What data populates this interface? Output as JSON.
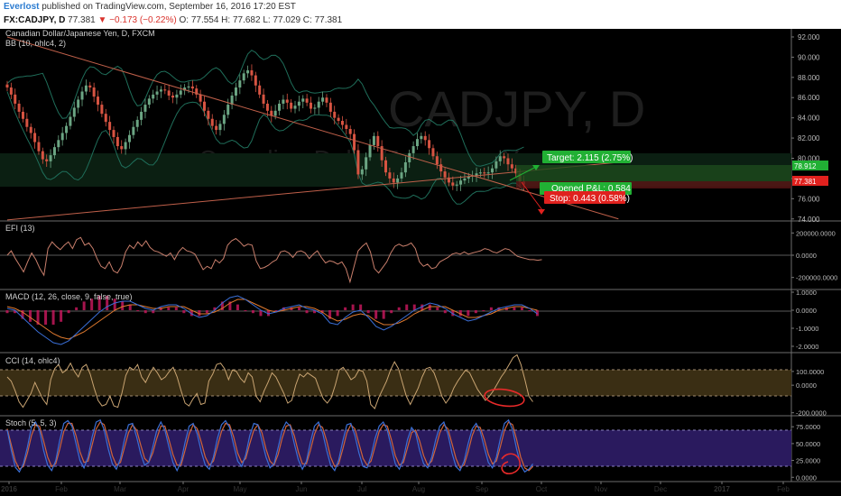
{
  "header": {
    "brand": "Everlost",
    "published": "published on TradingView.com, September 16, 2016 17:20 EST",
    "symbol": "FX:CADJPY, D",
    "last": "77.381",
    "change_arrow": "▼",
    "change": "−0.173 (−0.22%)",
    "ohlc": "O: 77.554  H: 77.682  L: 77.029  C: 77.381"
  },
  "colors": {
    "background": "#000000",
    "candle_up": "#6ba583",
    "candle_down": "#d75442",
    "bollinger": "#1f6e5a",
    "trendline": "#c0604a",
    "indicator_line": "#c9a472",
    "macd_line": "#3a6fd8",
    "signal_line": "#e07a2f",
    "histogram": "#c2185b",
    "stoch_k": "#3b6fd6",
    "stoch_d": "#d0643a",
    "stoch_band": "#2a1a5e",
    "cci_band": "#3a2e14",
    "target_green": "#21b034",
    "stop_red": "#e0211e",
    "annotation_red": "#e82a2a"
  },
  "chart_data": [
    {
      "panel": "price",
      "type": "candlestick",
      "title": "Canadian Dollar/Japanese Yen, D, FXCM",
      "overlay_label": "BB (10, ohlc4, 2)",
      "watermark": "CADJPY, D",
      "watermark_sub": "Canadian Dollar/Japanese Yen",
      "x_ticks": [
        "2016",
        "Feb",
        "Mar",
        "Apr",
        "May",
        "Jun",
        "Jul",
        "Aug",
        "Sep",
        "Oct",
        "Nov",
        "Dec",
        "2017",
        "Feb"
      ],
      "y_ticks": [
        "92.000",
        "90.000",
        "88.000",
        "86.000",
        "84.000",
        "82.000",
        "80.000",
        "78.000",
        "76.000",
        "74.000"
      ],
      "ylim": [
        73.8,
        92.8
      ],
      "closes": [
        87.0,
        86.3,
        85.4,
        84.6,
        83.9,
        83.1,
        82.5,
        81.6,
        80.7,
        79.9,
        79.7,
        80.3,
        81.1,
        81.8,
        82.5,
        83.2,
        84.1,
        85.0,
        85.8,
        86.6,
        87.2,
        87.0,
        86.1,
        85.3,
        84.4,
        83.6,
        82.8,
        82.1,
        81.2,
        80.9,
        81.6,
        82.3,
        83.1,
        83.8,
        84.6,
        85.3,
        85.9,
        86.3,
        86.6,
        86.8,
        86.7,
        86.2,
        86.0,
        86.3,
        86.7,
        87.0,
        87.1,
        86.9,
        86.3,
        85.6,
        84.7,
        83.9,
        83.2,
        82.8,
        83.4,
        84.3,
        85.3,
        86.2,
        87.0,
        87.7,
        88.4,
        88.7,
        88.2,
        87.2,
        86.3,
        85.4,
        84.7,
        84.2,
        84.7,
        85.4,
        85.8,
        85.5,
        84.9,
        85.2,
        85.6,
        85.9,
        85.5,
        84.9,
        85.0,
        85.6,
        86.0,
        85.5,
        84.6,
        84.0,
        83.7,
        83.3,
        82.9,
        82.4,
        80.8,
        78.4,
        78.9,
        80.1,
        81.3,
        82.2,
        81.2,
        79.8,
        78.6,
        78.0,
        77.6,
        78.0,
        78.6,
        79.6,
        80.5,
        81.2,
        81.9,
        82.2,
        81.8,
        81.0,
        80.2,
        79.4,
        78.7,
        78.1,
        77.6,
        77.3,
        77.4,
        77.8,
        78.0,
        78.2,
        78.3,
        78.5,
        78.6,
        78.5,
        78.6,
        79.0,
        79.7,
        80.2,
        80.0,
        79.4,
        79.0,
        78.5,
        77.7,
        77.4
      ],
      "last_price_label": "77.381",
      "bb_upper_label": "78.912",
      "trendline_points": [
        [
          0,
          92.0
        ],
        [
          155,
          74.0
        ]
      ],
      "support_line_points": [
        [
          0,
          73.9
        ],
        [
          155,
          79.6
        ]
      ],
      "target_label": "Target: 2.115 (2.75%)",
      "stop_label": "Stop: 0.443 (0.58%)",
      "pnl_label": "Opened P&L: 0.584"
    },
    {
      "panel": "efi",
      "type": "line",
      "label": "EFI (13)",
      "y_ticks": [
        "200000.0000",
        "0.0000",
        "-200000.0000"
      ],
      "ylim": [
        -300000,
        300000
      ],
      "series": [
        {
          "values": [
            0,
            40000,
            -30000,
            -90000,
            -150000,
            -60000,
            20000,
            -40000,
            -120000,
            -180000,
            60000,
            120000,
            80000,
            50000,
            90000,
            120000,
            60000,
            140000,
            160000,
            90000,
            110000,
            60000,
            -30000,
            -100000,
            -120000,
            -60000,
            -140000,
            -160000,
            -100000,
            30000,
            90000,
            60000,
            120000,
            80000,
            130000,
            70000,
            40000,
            30000,
            10000,
            -10000,
            20000,
            -40000,
            30000,
            70000,
            40000,
            30000,
            10000,
            -60000,
            -130000,
            -100000,
            -120000,
            -40000,
            -70000,
            -30000,
            90000,
            130000,
            150000,
            120000,
            80000,
            100000,
            90000,
            -50000,
            -120000,
            -110000,
            -90000,
            -60000,
            -40000,
            30000,
            40000,
            20000,
            -20000,
            30000,
            40000,
            20000,
            -30000,
            10000,
            40000,
            -20000,
            -70000,
            -50000,
            -60000,
            -80000,
            -60000,
            -120000,
            -240000,
            -100000,
            40000,
            80000,
            110000,
            30000,
            -120000,
            -160000,
            -110000,
            -60000,
            20000,
            80000,
            100000,
            80000,
            90000,
            110000,
            60000,
            -60000,
            -100000,
            -80000,
            -120000,
            -110000,
            -60000,
            -40000,
            -20000,
            10000,
            20000,
            10000,
            30000,
            10000,
            20000,
            30000,
            40000,
            60000,
            50000,
            30000,
            20000,
            40000,
            60000,
            50000,
            20000,
            -10000,
            -20000,
            -30000,
            -40000,
            -40000,
            -45000,
            -40000
          ]
        }
      ]
    },
    {
      "panel": "macd",
      "type": "line",
      "label": "MACD (12, 26, close, 9, false, true)",
      "y_ticks": [
        "1.0000",
        "0.0000",
        "-1.0000",
        "-2.0000"
      ],
      "ylim": [
        -2.3,
        1.1
      ],
      "series": [
        {
          "values": [
            0.1,
            0.0,
            -0.4,
            -0.8,
            -1.2,
            -1.5,
            -1.8,
            -1.9,
            -1.7,
            -1.3,
            -0.9,
            -0.5,
            -0.1,
            0.2,
            0.4,
            0.5,
            0.5,
            0.3,
            0.1,
            0.0,
            0.2,
            0.3,
            0.3,
            0.1,
            -0.2,
            -0.4,
            -0.3,
            0.0,
            0.4,
            0.7,
            0.8,
            0.6,
            0.3,
            0.0,
            -0.2,
            -0.1,
            0.1,
            0.2,
            0.3,
            0.1,
            0.0,
            -0.2,
            -0.7,
            -0.8,
            -0.4,
            -0.1,
            0.0,
            -0.4,
            -0.9,
            -1.1,
            -0.9,
            -0.6,
            -0.3,
            0.0,
            0.2,
            0.4,
            0.3,
            0.1,
            -0.2,
            -0.4,
            -0.6,
            -0.5,
            -0.3,
            -0.1,
            0.1,
            0.2,
            0.3,
            0.3,
            0.1,
            -0.2
          ]
        },
        {
          "values": [
            0.2,
            0.1,
            -0.1,
            -0.4,
            -0.7,
            -1.0,
            -1.3,
            -1.5,
            -1.6,
            -1.4,
            -1.2,
            -0.9,
            -0.6,
            -0.3,
            0.0,
            0.2,
            0.3,
            0.3,
            0.2,
            0.1,
            0.1,
            0.2,
            0.2,
            0.2,
            0.0,
            -0.2,
            -0.2,
            -0.1,
            0.1,
            0.4,
            0.6,
            0.6,
            0.4,
            0.2,
            0.0,
            -0.1,
            0.0,
            0.1,
            0.2,
            0.2,
            0.1,
            -0.1,
            -0.4,
            -0.6,
            -0.5,
            -0.3,
            -0.2,
            -0.3,
            -0.6,
            -0.8,
            -0.8,
            -0.7,
            -0.5,
            -0.2,
            0.0,
            0.2,
            0.2,
            0.2,
            0.0,
            -0.2,
            -0.4,
            -0.4,
            -0.3,
            -0.2,
            0.0,
            0.1,
            0.2,
            0.2,
            0.1,
            0.0
          ]
        }
      ]
    },
    {
      "panel": "cci",
      "type": "line",
      "label": "CCI (14, ohlc4)",
      "y_ticks": [
        "100.0000",
        "0.0000",
        "-200.0000"
      ],
      "ylim": [
        -215,
        230
      ],
      "series": [
        {
          "values": [
            60,
            30,
            -40,
            -120,
            -160,
            -110,
            -60,
            20,
            -40,
            -100,
            -140,
            40,
            120,
            150,
            90,
            110,
            160,
            100,
            60,
            130,
            150,
            80,
            -20,
            -110,
            -150,
            -140,
            -80,
            -150,
            -160,
            -60,
            70,
            130,
            110,
            150,
            60,
            20,
            80,
            130,
            90,
            40,
            60,
            100,
            130,
            60,
            -40,
            -130,
            -150,
            -100,
            -60,
            -140,
            -130,
            30,
            80,
            150,
            160,
            120,
            40,
            110,
            100,
            50,
            20,
            90,
            60,
            -80,
            -120,
            -40,
            20,
            90,
            60,
            0,
            -60,
            -130,
            -110,
            0,
            80,
            60,
            90,
            70,
            50,
            -30,
            -100,
            -130,
            -90,
            0,
            110,
            130,
            90,
            40,
            60,
            110,
            100,
            30,
            -140,
            -170,
            -90,
            -30,
            30,
            110,
            170,
            120,
            20,
            -80,
            -140,
            -80,
            -20,
            60,
            120,
            130,
            90,
            10,
            -80,
            -130,
            -90,
            -20,
            30,
            70,
            110,
            90,
            30,
            -30,
            -70,
            -110,
            -80,
            -40,
            10,
            60,
            100,
            150,
            200,
            220,
            150,
            40,
            -80,
            -120
          ]
        }
      ]
    },
    {
      "panel": "stoch",
      "type": "line",
      "label": "Stoch (5, 5, 3)",
      "y_ticks": [
        "75.0000",
        "50.0000",
        "25.0000",
        "0.0000"
      ],
      "ylim": [
        -5,
        90
      ],
      "series": [
        {
          "values": [
            70,
            40,
            15,
            8,
            20,
            45,
            75,
            82,
            70,
            40,
            18,
            10,
            25,
            55,
            80,
            84,
            76,
            50,
            25,
            14,
            30,
            60,
            82,
            85,
            70,
            42,
            20,
            12,
            28,
            56,
            78,
            80,
            60,
            35,
            18,
            22,
            45,
            70,
            82,
            70,
            45,
            22,
            10,
            24,
            52,
            76,
            80,
            64,
            38,
            18,
            12,
            30,
            58,
            78,
            84,
            74,
            48,
            24,
            16,
            34,
            62,
            80,
            78,
            54,
            30,
            14,
            20,
            44,
            70,
            82,
            76,
            50,
            26,
            12,
            24,
            52,
            76,
            82,
            66,
            40,
            18,
            10,
            26,
            54,
            78,
            80,
            62,
            36,
            16,
            14,
            32,
            58,
            76,
            82,
            70,
            44,
            20,
            12,
            28,
            56,
            74,
            66,
            40,
            20,
            14,
            30,
            56,
            76,
            82,
            64,
            36,
            16,
            10,
            24,
            50,
            72,
            80,
            68,
            44,
            22,
            14,
            30,
            58,
            80,
            85,
            70,
            42,
            18,
            8,
            12,
            20
          ]
        },
        {
          "values": [
            72,
            48,
            24,
            12,
            16,
            36,
            62,
            78,
            76,
            54,
            30,
            16,
            20,
            42,
            68,
            80,
            80,
            62,
            38,
            22,
            24,
            48,
            72,
            82,
            78,
            56,
            32,
            18,
            22,
            44,
            66,
            78,
            70,
            48,
            28,
            22,
            36,
            58,
            76,
            76,
            56,
            34,
            18,
            18,
            40,
            64,
            78,
            72,
            52,
            30,
            18,
            24,
            46,
            68,
            80,
            78,
            60,
            36,
            22,
            28,
            50,
            70,
            78,
            66,
            42,
            24,
            18,
            34,
            58,
            76,
            78,
            62,
            38,
            20,
            20,
            40,
            64,
            78,
            74,
            54,
            30,
            16,
            20,
            42,
            66,
            78,
            72,
            50,
            28,
            18,
            24,
            46,
            68,
            78,
            76,
            56,
            32,
            18,
            22,
            44,
            66,
            70,
            54,
            32,
            18,
            24,
            44,
            66,
            78,
            72,
            50,
            28,
            14,
            18,
            38,
            62,
            76,
            74,
            56,
            34,
            20,
            24,
            46,
            70,
            82,
            78,
            56,
            30,
            14,
            10,
            16
          ]
        }
      ]
    }
  ]
}
